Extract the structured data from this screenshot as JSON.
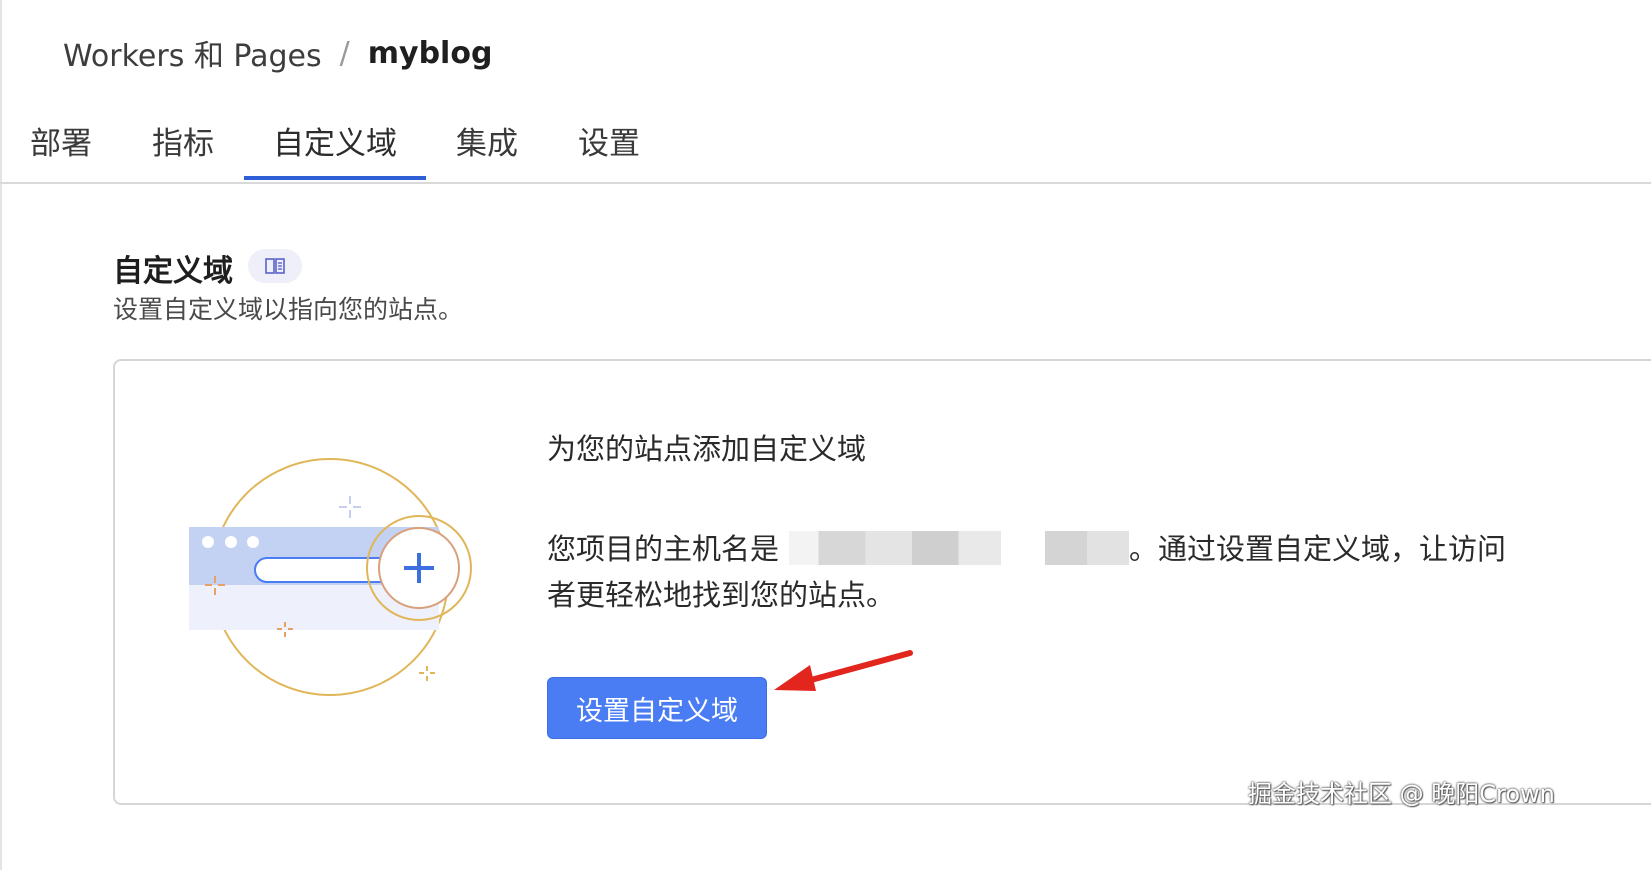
{
  "breadcrumb": {
    "parent": "Workers 和 Pages",
    "separator": "/",
    "current": "myblog"
  },
  "tabs": [
    {
      "label": "部署"
    },
    {
      "label": "指标"
    },
    {
      "label": "自定义域"
    },
    {
      "label": "集成"
    },
    {
      "label": "设置"
    }
  ],
  "active_tab": "自定义域",
  "section": {
    "title": "自定义域",
    "description": "设置自定义域以指向您的站点。"
  },
  "card": {
    "heading": "为您的站点添加自定义域",
    "body_prefix": "您项目的主机名是",
    "body_suffix": "。通过设置自定义域，让访问者更轻松地找到您的站点。",
    "button_label": "设置自定义域"
  },
  "watermark": "掘金技术社区 @ 晚阳Crown",
  "colors": {
    "primary": "#4a7cf3",
    "tab_underline": "#2f5fd6",
    "annotation_arrow": "#e2261e"
  }
}
